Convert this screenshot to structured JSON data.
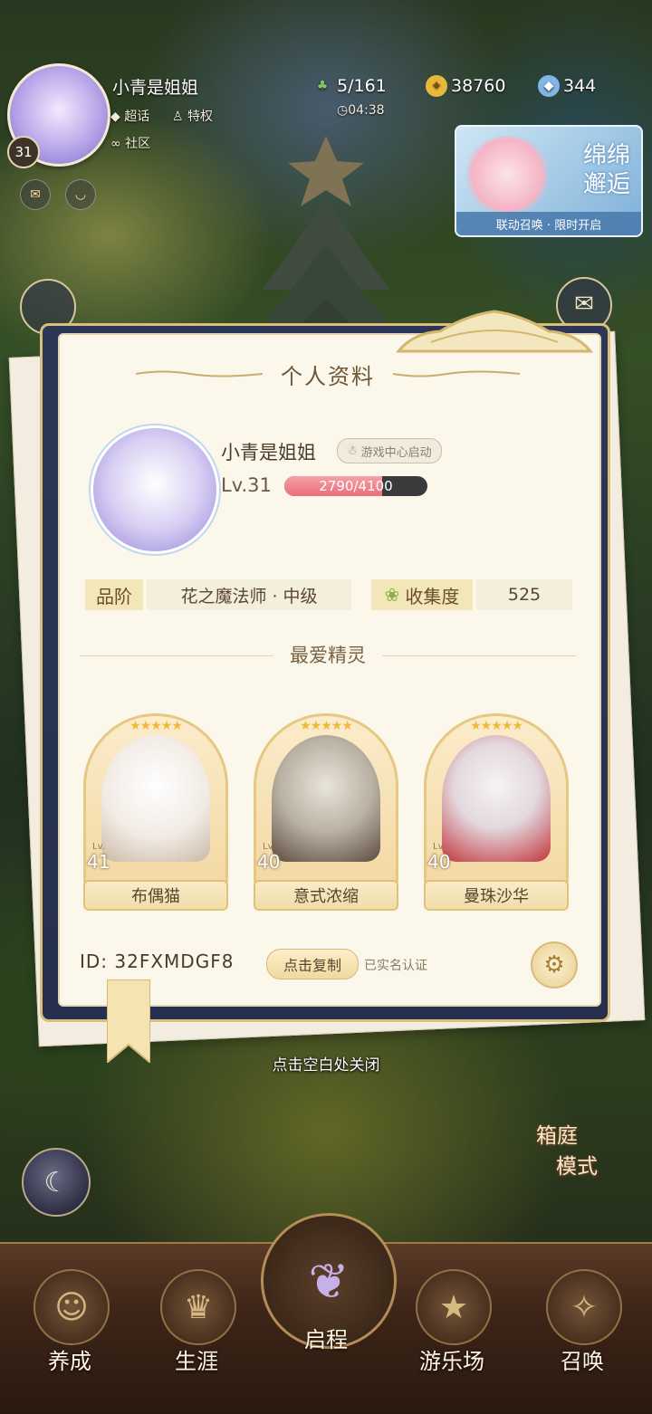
{
  "topbar": {
    "player_name": "小青是姐姐",
    "level": "31",
    "tags": [
      "超话",
      "特权",
      "社区"
    ],
    "stamina": "5/161",
    "gold": "38760",
    "gems": "344",
    "timer": "04:38"
  },
  "banner": {
    "title_line1": "绵绵",
    "title_line2": "邂逅",
    "footer": "联动召唤 · 限时开启"
  },
  "profile": {
    "heading": "个人资料",
    "name": "小青是姐姐",
    "badge": "游戏中心启动",
    "level_label": "Lv.31",
    "xp_text": "2790/4100",
    "xp_current": 2790,
    "xp_max": 4100,
    "rank_label": "品阶",
    "rank_value": "花之魔法师 · 中级",
    "collection_label": "收集度",
    "collection_value": "525",
    "favorites_heading": "最爱精灵",
    "spirits": [
      {
        "name": "布偶猫",
        "lv_prefix": "Lv.",
        "level": "41",
        "stars": "★★★★★"
      },
      {
        "name": "意式浓缩",
        "lv_prefix": "Lv.",
        "level": "40",
        "stars": "★★★★★"
      },
      {
        "name": "曼珠沙华",
        "lv_prefix": "Lv.",
        "level": "40",
        "stars": "★★★★★"
      }
    ],
    "id_text": "ID:  32FXMDGF8",
    "copy_label": "点击复制",
    "verified": "已实名认证"
  },
  "close_hint": "点击空白处关闭",
  "garden": {
    "line1": "箱庭",
    "line2": "模式"
  },
  "nav": {
    "items": [
      "养成",
      "生涯",
      "启程",
      "游乐场",
      "召唤"
    ]
  },
  "colors": {
    "accent_gold": "#d8c07a",
    "xp_fill": "#e86e7b",
    "card_bg": "#fbf7ea"
  }
}
